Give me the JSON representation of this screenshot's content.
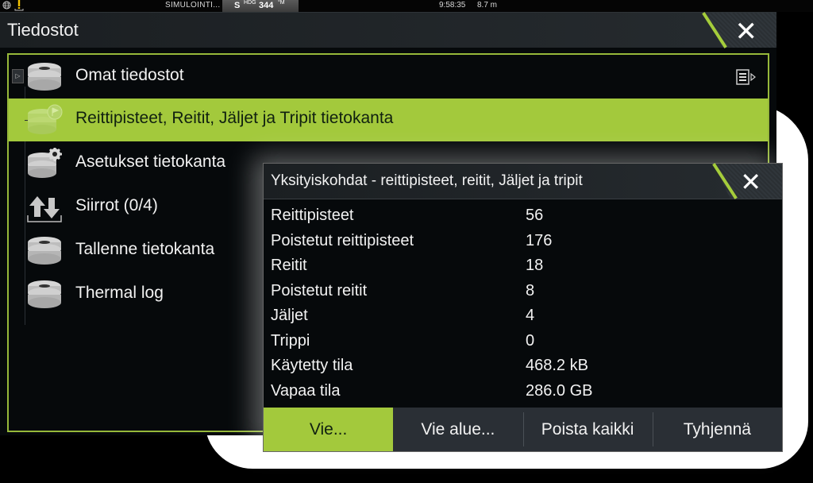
{
  "statusbar": {
    "left_icons": [
      "globe-icon",
      "alert-icon"
    ],
    "mode": "SIMULOINTI...",
    "heading": {
      "prefix": "S",
      "label": "HDG",
      "value": "344",
      "unit": "°M"
    },
    "time": "9:58:35",
    "depth": "8.7 m"
  },
  "window": {
    "title": "Tiedostot",
    "close_icon": "close-icon"
  },
  "files": {
    "items": [
      {
        "label": "Omat tiedostot",
        "icon": "database-icon",
        "expandable": true,
        "menu_icon": "list-menu-icon",
        "selected": false
      },
      {
        "label": "Reittipisteet, Reitit, Jäljet ja Tripit tietokanta",
        "icon": "database-flag-icon",
        "selected": true
      },
      {
        "label": "Asetukset tietokanta",
        "icon": "database-gear-icon",
        "selected": false
      },
      {
        "label": "Siirrot (0/4)",
        "icon": "transfer-icon",
        "selected": false
      },
      {
        "label": "Tallenne tietokanta",
        "icon": "database-icon",
        "selected": false
      },
      {
        "label": "Thermal log",
        "icon": "database-icon",
        "selected": false
      }
    ]
  },
  "dialog": {
    "title": "Yksityiskohdat - reittipisteet, reitit, Jäljet ja tripit",
    "details": [
      {
        "key": "Reittipisteet",
        "value": "56"
      },
      {
        "key": "Poistetut reittipisteet",
        "value": "176"
      },
      {
        "key": "Reitit",
        "value": "18"
      },
      {
        "key": "Poistetut reitit",
        "value": "8"
      },
      {
        "key": "Jäljet",
        "value": "4"
      },
      {
        "key": "Trippi",
        "value": "0"
      },
      {
        "key": "Käytetty tila",
        "value": "468.2 kB"
      },
      {
        "key": "Vapaa tila",
        "value": "286.0 GB"
      }
    ],
    "buttons": [
      {
        "label": "Vie...",
        "active": true
      },
      {
        "label": "Vie alue...",
        "active": false
      },
      {
        "label": "Poista kaikki",
        "active": false
      },
      {
        "label": "Tyhjennä",
        "active": false
      }
    ]
  },
  "colors": {
    "accent": "#a3c93c",
    "frame": "#96b83a",
    "background": "#06090b",
    "titlebar": "#22272b"
  }
}
